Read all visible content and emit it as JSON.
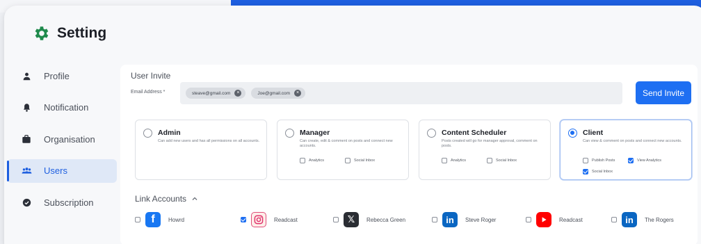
{
  "header": {
    "title": "Setting",
    "icon": "gear-icon",
    "icon_color": "#1f8a4c"
  },
  "sidebar": {
    "items": [
      {
        "label": "Profile",
        "icon": "user-icon",
        "active": false
      },
      {
        "label": "Notification",
        "icon": "bell-icon",
        "active": false
      },
      {
        "label": "Organisation",
        "icon": "briefcase-icon",
        "active": false
      },
      {
        "label": "Users",
        "icon": "users-icon",
        "active": true
      },
      {
        "label": "Subscription",
        "icon": "check-circle-icon",
        "active": false
      }
    ]
  },
  "invite": {
    "title": "User Invite",
    "email_label": "Email Address *",
    "emails": [
      "steave@gmail.com",
      "Joe@gmail.com"
    ],
    "send_label": "Send Invite"
  },
  "roles": [
    {
      "name": "Admin",
      "description": "Can add new users and has all permissions on all accounts.",
      "selected": false,
      "permissions": []
    },
    {
      "name": "Manager",
      "description": "Can create, edit & comment on posts and connect new accounts.",
      "selected": false,
      "permissions": [
        {
          "label": "Analytics",
          "checked": false
        },
        {
          "label": "Social Inbox",
          "checked": false
        }
      ]
    },
    {
      "name": "Content Scheduler",
      "description": "Posts created will go for manager approval, comment on posts.",
      "selected": false,
      "permissions": [
        {
          "label": "Analytics",
          "checked": false
        },
        {
          "label": "Social Inbox",
          "checked": false
        }
      ]
    },
    {
      "name": "Client",
      "description": "Can view & comment on posts and connect new accounts.",
      "selected": true,
      "permissions": [
        {
          "label": "Publish Posts",
          "checked": false
        },
        {
          "label": "View Analytics",
          "checked": true
        },
        {
          "label": "Social Inbox",
          "checked": true
        }
      ]
    }
  ],
  "link_accounts": {
    "title": "Link Accounts",
    "accounts": [
      {
        "network": "facebook",
        "icon": "facebook-icon",
        "name": "Howrd",
        "checked": false
      },
      {
        "network": "instagram",
        "icon": "instagram-icon",
        "name": "Readcast",
        "checked": true
      },
      {
        "network": "x",
        "icon": "x-icon",
        "name": "Rebecca Green",
        "checked": false
      },
      {
        "network": "linkedin",
        "icon": "linkedin-icon",
        "name": "Steve Roger",
        "checked": false
      },
      {
        "network": "youtube",
        "icon": "youtube-icon",
        "name": "Readcast",
        "checked": false
      },
      {
        "network": "linkedin",
        "icon": "linkedin-icon",
        "name": "The Rogers",
        "checked": false
      }
    ]
  },
  "colors": {
    "accent": "#1e6ff2",
    "brand_band": "#1e5fe0"
  }
}
